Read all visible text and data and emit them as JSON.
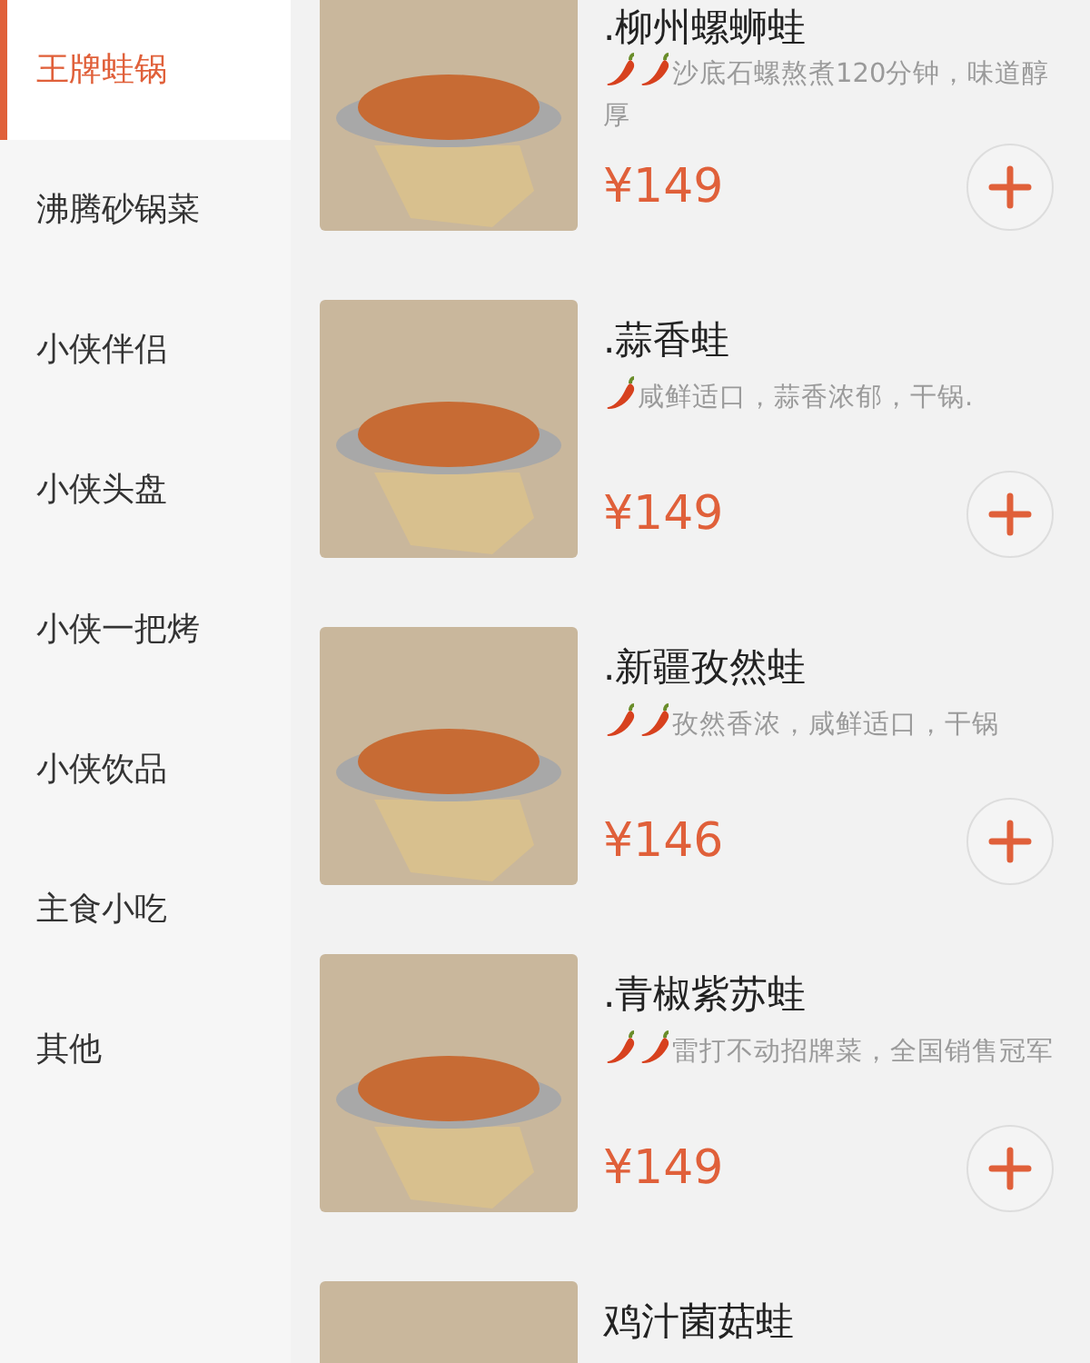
{
  "sidebar": {
    "items": [
      {
        "label": "王牌蛙锅",
        "selected": true
      },
      {
        "label": "沸腾砂锅菜",
        "selected": false
      },
      {
        "label": "小侠伴侣",
        "selected": false
      },
      {
        "label": "小侠头盘",
        "selected": false
      },
      {
        "label": "小侠一把烤",
        "selected": false
      },
      {
        "label": "小侠饮品",
        "selected": false
      },
      {
        "label": "主食小吃",
        "selected": false
      },
      {
        "label": "其他",
        "selected": false
      }
    ]
  },
  "dishes": [
    {
      "name": ".柳州螺蛳蛙",
      "icons": [
        {
          "kind": "chili"
        },
        {
          "kind": "chili"
        }
      ],
      "description": "沙底石螺熬煮120分钟，味道醇厚",
      "price": "¥149"
    },
    {
      "name": ".蒜香蛙",
      "icons": [
        {
          "kind": "chili"
        }
      ],
      "description": "咸鲜适口，蒜香浓郁，干锅.",
      "price": "¥149"
    },
    {
      "name": ".新疆孜然蛙",
      "icons": [
        {
          "kind": "chili"
        },
        {
          "kind": "chili"
        }
      ],
      "description": "孜然香浓，咸鲜适口，干锅",
      "price": "¥146"
    },
    {
      "name": ".青椒紫苏蛙",
      "icons": [
        {
          "kind": "chili"
        },
        {
          "kind": "chili"
        }
      ],
      "description": "雷打不动招牌菜，全国销售冠军",
      "price": "¥149"
    },
    {
      "name": "鸡汁菌菇蛙"
    }
  ]
}
